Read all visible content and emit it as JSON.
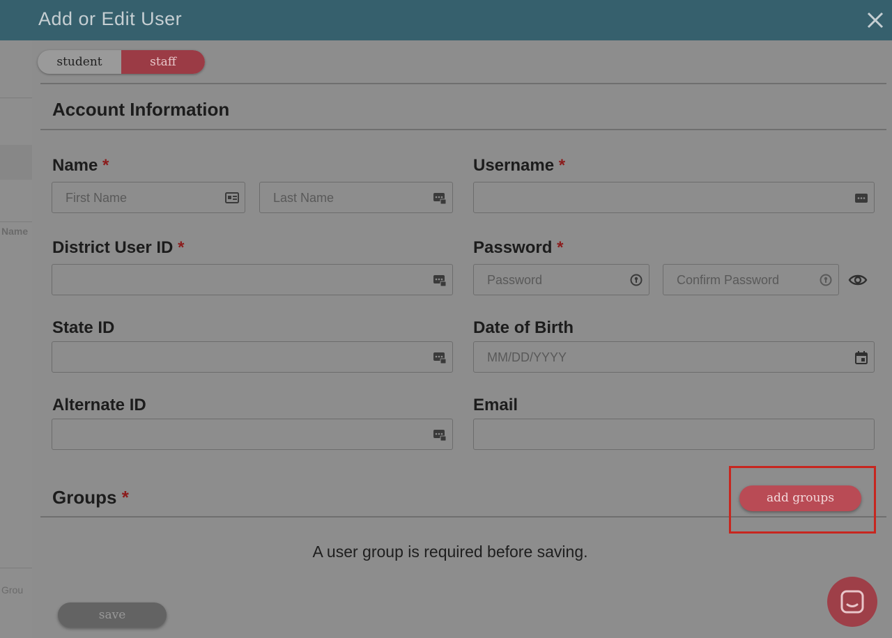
{
  "background": {
    "column_name_fragment": "Name",
    "group_fragment": "Grou"
  },
  "modal": {
    "title": "Add or Edit User",
    "close_icon": "close-icon"
  },
  "role_toggle": {
    "options": [
      "student",
      "staff"
    ],
    "selected": "staff"
  },
  "account_section": {
    "title": "Account Information",
    "fields": {
      "name": {
        "label": "Name",
        "required_mark": "*",
        "first_placeholder": "First Name",
        "last_placeholder": "Last Name"
      },
      "username": {
        "label": "Username",
        "required_mark": "*"
      },
      "district_user_id": {
        "label": "District User ID",
        "required_mark": "*"
      },
      "password": {
        "label": "Password",
        "required_mark": "*",
        "placeholder": "Password",
        "confirm_placeholder": "Confirm Password"
      },
      "state_id": {
        "label": "State ID"
      },
      "date_of_birth": {
        "label": "Date of Birth",
        "placeholder": "MM/DD/YYYY"
      },
      "alternate_id": {
        "label": "Alternate ID"
      },
      "email": {
        "label": "Email"
      }
    }
  },
  "groups_section": {
    "title": "Groups",
    "required_mark": "*",
    "add_button": "add groups",
    "notice": "A user group is required before saving."
  },
  "footer": {
    "save_button": "save"
  },
  "colors": {
    "header": "#36606d",
    "accent": "#b94b55",
    "required": "#8b1c1c",
    "highlight": "#c7261f"
  }
}
